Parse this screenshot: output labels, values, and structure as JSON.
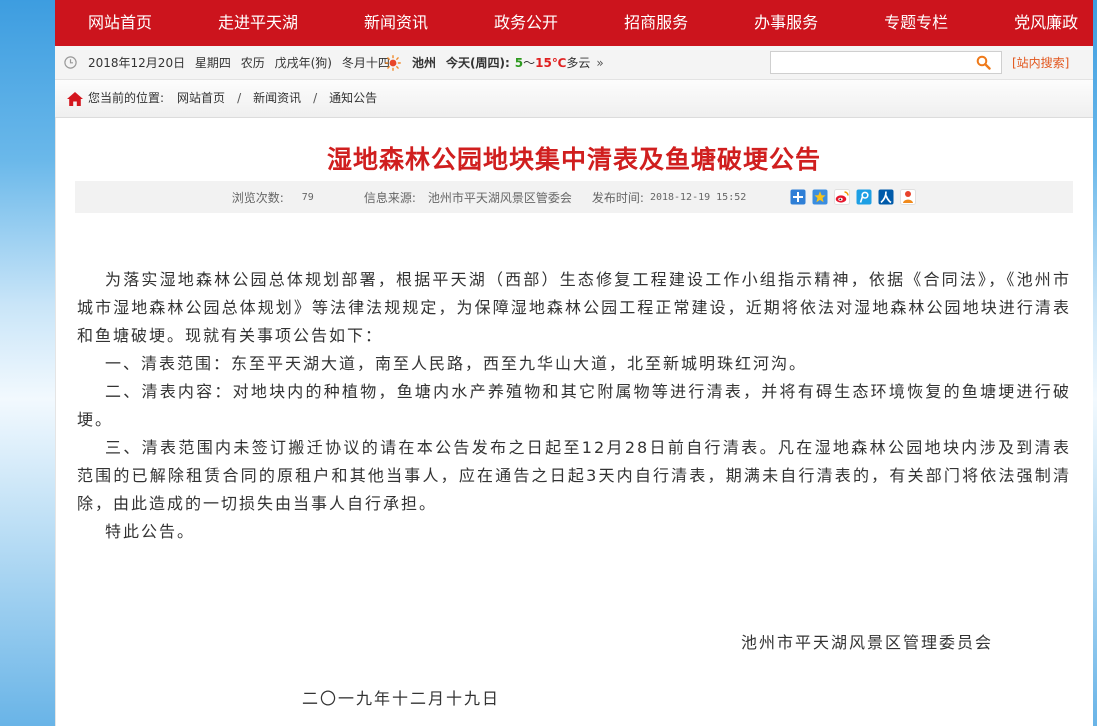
{
  "colors": {
    "nav_bg": "#cc141d",
    "title": "#d01f1f",
    "search_link": "#e2571e",
    "temp_low": "#2e9a1f",
    "temp_high": "#e02020"
  },
  "nav": {
    "items": [
      {
        "label": "网站首页"
      },
      {
        "label": "走进平天湖"
      },
      {
        "label": "新闻资讯"
      },
      {
        "label": "政务公开"
      },
      {
        "label": "招商服务"
      },
      {
        "label": "办事服务"
      },
      {
        "label": "专题专栏"
      },
      {
        "label": "党风廉政"
      }
    ]
  },
  "topbar": {
    "icons": {
      "clock": "clock-icon",
      "weather": "sun-icon",
      "search": "search-icon"
    },
    "date": "2018年12月20日",
    "weekday": "星期四",
    "lunar_label": "农历",
    "lunar_year": "戊戌年(狗)",
    "lunar_day": "冬月十四",
    "weather": {
      "city": "池州",
      "day_label": "今天(周四):",
      "low": "5",
      "separator": "～",
      "high": "15℃",
      "condition": "多云",
      "more": "»"
    },
    "search": {
      "value": "",
      "button_label": "[站内搜索]"
    }
  },
  "breadcrumb": {
    "icon": "home-icon",
    "prefix": "您当前的位置:",
    "separator": "/",
    "items": [
      "网站首页",
      "新闻资讯",
      "通知公告"
    ]
  },
  "article": {
    "title": "湿地森林公园地块集中清表及鱼塘破埂公告",
    "meta": {
      "views_label": "浏览次数:",
      "views": "79",
      "source_label": "信息来源:",
      "source": "池州市平天湖风景区管委会",
      "time_label": "发布时间:",
      "time": "2018-12-19 15:52"
    },
    "share_icons": [
      "share-more-icon",
      "qzone-icon",
      "sina-weibo-icon",
      "tencent-weibo-icon",
      "renren-icon",
      "kaixin-icon"
    ],
    "paragraphs": [
      "为落实湿地森林公园总体规划部署，根据平天湖（西部）生态修复工程建设工作小组指示精神，依据《合同法》，《池州市城市湿地森林公园总体规划》等法律法规规定，为保障湿地森林公园工程正常建设，近期将依法对湿地森林公园地块进行清表和鱼塘破埂。现就有关事项公告如下：",
      "一、清表范围：东至平天湖大道，南至人民路，西至九华山大道，北至新城明珠红河沟。",
      "二、清表内容：对地块内的种植物，鱼塘内水产养殖物和其它附属物等进行清表，并将有碍生态环境恢复的鱼塘埂进行破埂。",
      "三、清表范围内未签订搬迁协议的请在本公告发布之日起至12月28日前自行清表。凡在湿地森林公园地块内涉及到清表范围的已解除租赁合同的原租户和其他当事人，应在通告之日起3天内自行清表，期满未自行清表的，有关部门将依法强制清除，由此造成的一切损失由当事人自行承担。",
      "特此公告。"
    ],
    "signature": "池州市平天湖风景区管理委员会",
    "date": "二〇一九年十二月十九日"
  }
}
